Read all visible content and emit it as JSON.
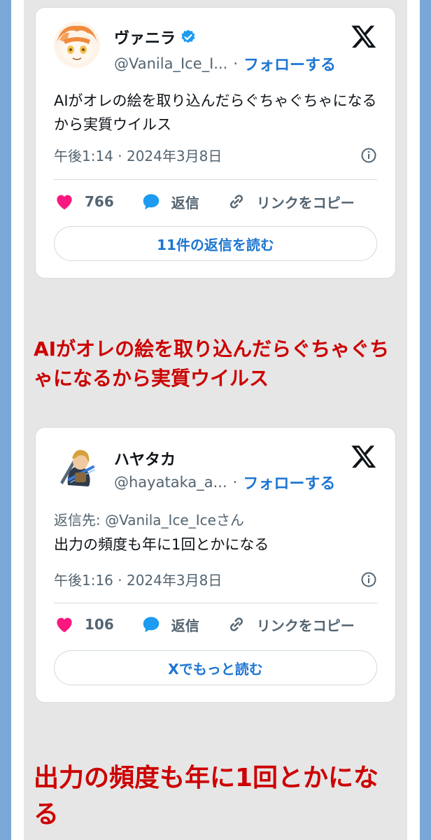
{
  "tweets": [
    {
      "display_name": "ヴァニラ",
      "verified": true,
      "handle": "@Vanila_Ice_I...",
      "separator": "·",
      "follow_label": "フォローする",
      "reply_to_label": "",
      "reply_to_handle": "",
      "text": "AIがオレの絵を取り込んだらぐちゃぐちゃになるから実質ウイルス",
      "time": "午後1:14 · 2024年3月8日",
      "likes": "766",
      "reply_label": "返信",
      "copy_link_label": "リンクをコピー",
      "read_button_label": "11件の返信を読む"
    },
    {
      "display_name": "ハヤタカ",
      "verified": false,
      "handle": "@hayataka_a...",
      "separator": "·",
      "follow_label": "フォローする",
      "reply_to_label": "返信先: ",
      "reply_to_handle": "@Vanila_Ice_Iceさん",
      "text": "出力の頻度も年に1回とかになる",
      "time": "午後1:16 · 2024年3月8日",
      "likes": "106",
      "reply_label": "返信",
      "copy_link_label": "リンクをコピー",
      "read_button_label": "Xでもっと読む"
    }
  ],
  "captions": [
    "AIがオレの絵を取り込んだらぐちゃぐちゃになるから実質ウイルス",
    "出力の頻度も年に1回とかになる"
  ],
  "icons": {
    "heart": "heart-icon",
    "reply": "speech-bubble-icon",
    "copy_link": "link-icon",
    "info": "info-icon",
    "x_logo": "x-logo-icon",
    "verified": "verified-badge-icon"
  },
  "colors": {
    "follow": "#1d75d1",
    "heart": "#f91880",
    "caption": "#cc0000",
    "frame": "#7aa7d8"
  }
}
